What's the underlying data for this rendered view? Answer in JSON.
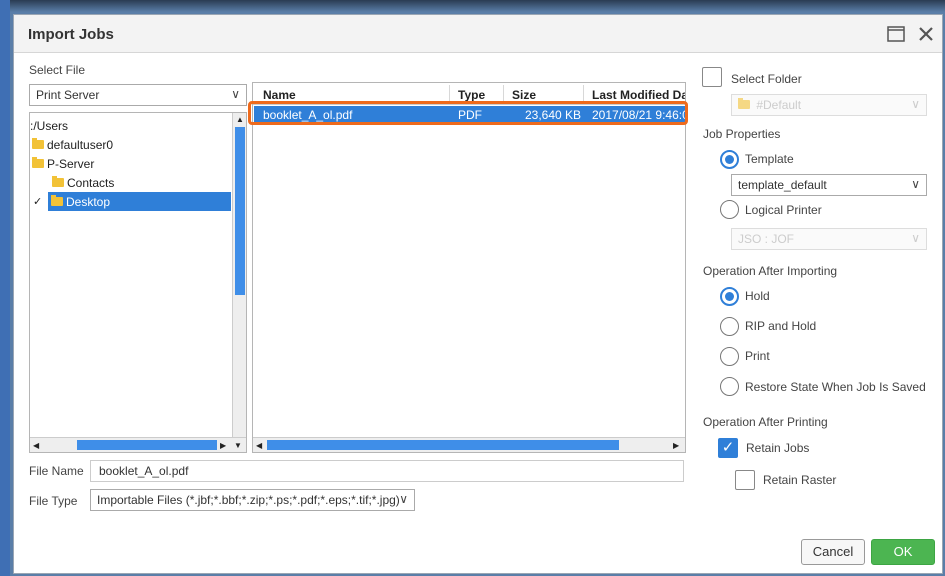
{
  "dialog": {
    "title": "Import Jobs"
  },
  "left": {
    "select_file_label": "Select File",
    "source_select": "Print Server",
    "tree": [
      {
        "label": ":/Users"
      },
      {
        "label": "defaultuser0"
      },
      {
        "label": "P-Server"
      },
      {
        "label": "Contacts"
      },
      {
        "label": "Desktop"
      }
    ]
  },
  "filelist": {
    "columns": [
      "Name",
      "Type",
      "Size",
      "Last Modified Da"
    ],
    "rows": [
      {
        "name": "booklet_A_ol.pdf",
        "type": "PDF",
        "size": "23,640 KB",
        "modified": "2017/08/21 9:46:0"
      }
    ]
  },
  "file_name": {
    "label": "File Name",
    "value": "booklet_A_ol.pdf"
  },
  "file_type": {
    "label": "File Type",
    "value": "Importable Files (*.jbf;*.bbf;*.zip;*.ps;*.pdf;*.eps;*.tif;*.jpg)"
  },
  "right": {
    "select_folder_label": "Select Folder",
    "folder_select": "#Default",
    "job_properties_label": "Job Properties",
    "template_label": "Template",
    "template_select": "template_default",
    "logical_printer_label": "Logical Printer",
    "logical_printer_select": "JSO : JOF",
    "after_importing_label": "Operation After Importing",
    "hold_label": "Hold",
    "rip_hold_label": "RIP and Hold",
    "print_label": "Print",
    "restore_label": "Restore State When Job Is Saved",
    "after_printing_label": "Operation After Printing",
    "retain_jobs_label": "Retain Jobs",
    "retain_raster_label": "Retain Raster"
  },
  "buttons": {
    "cancel": "Cancel",
    "ok": "OK"
  },
  "colors": {
    "selection": "#2f7fd8",
    "highlight_outline": "#ee6a1c",
    "ok_button": "#4cb551"
  }
}
